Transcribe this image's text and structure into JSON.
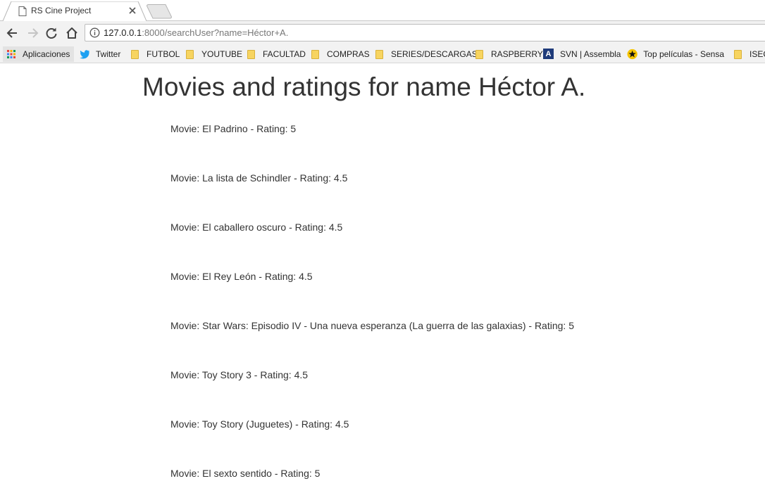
{
  "browser": {
    "tab": {
      "title": "RS Cine Project"
    },
    "url": {
      "host": "127.0.0.1",
      "rest": ":8000/searchUser?name=Héctor+A."
    },
    "bookmarks": [
      {
        "label": "Aplicaciones",
        "icon": "apps-grid-icon"
      },
      {
        "label": "Twitter",
        "icon": "twitter-bird-icon"
      },
      {
        "label": "FUTBOL",
        "icon": "folder-icon"
      },
      {
        "label": "YOUTUBE",
        "icon": "folder-icon"
      },
      {
        "label": "FACULTAD",
        "icon": "folder-icon"
      },
      {
        "label": "COMPRAS",
        "icon": "folder-icon"
      },
      {
        "label": "SERIES/DESCARGAS",
        "icon": "folder-icon"
      },
      {
        "label": "RASPBERRY",
        "icon": "folder-icon"
      },
      {
        "label": "SVN | Assembla",
        "icon": "assembla-icon",
        "icon_text": "A"
      },
      {
        "label": "Top películas - Sensa",
        "icon": "star-icon"
      },
      {
        "label": "ISEC",
        "icon": "folder-icon"
      }
    ]
  },
  "page": {
    "title": "Movies and ratings for name Héctor A.",
    "items": [
      "Movie: El Padrino - Rating: 5",
      "Movie: La lista de Schindler - Rating: 4.5",
      "Movie: El caballero oscuro - Rating: 4.5",
      "Movie: El Rey León - Rating: 4.5",
      "Movie: Star Wars: Episodio IV - Una nueva esperanza (La guerra de las galaxias) - Rating: 5",
      "Movie: Toy Story 3 - Rating: 4.5",
      "Movie: Toy Story (Juguetes) - Rating: 4.5",
      "Movie: El sexto sentido - Rating: 5"
    ]
  },
  "colors": {
    "twitter": "#1da1f2",
    "folder": "#f7d460",
    "assembla": "#1f3b7a",
    "text": "#333333"
  }
}
